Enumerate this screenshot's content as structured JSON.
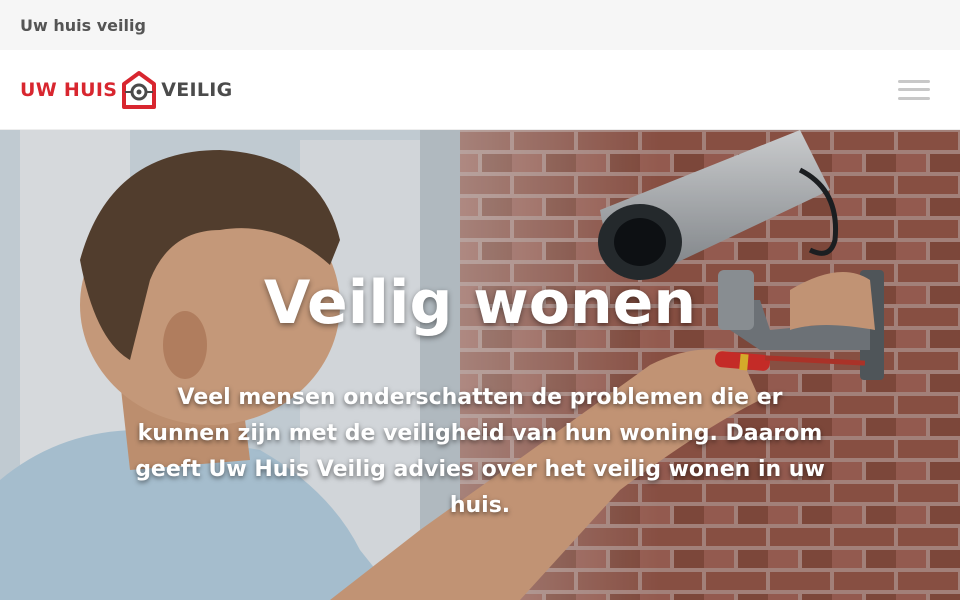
{
  "topbar": {
    "site_name": "Uw huis veilig"
  },
  "header": {
    "logo": {
      "part1": "UW HUIS",
      "part2": "VEILIG",
      "icon": "house-lock-icon"
    },
    "menu_icon": "hamburger-menu-icon"
  },
  "hero": {
    "title": "Veilig wonen",
    "text": "Veel mensen onderschatten de problemen die er kunnen zijn met de veiligheid van hun woning. Daarom geeft Uw Huis Veilig advies over het veilig wonen in uw huis."
  },
  "colors": {
    "brand_red": "#d8262f",
    "logo_grey": "#4b4b4b",
    "topbar_bg": "#f6f6f6"
  }
}
